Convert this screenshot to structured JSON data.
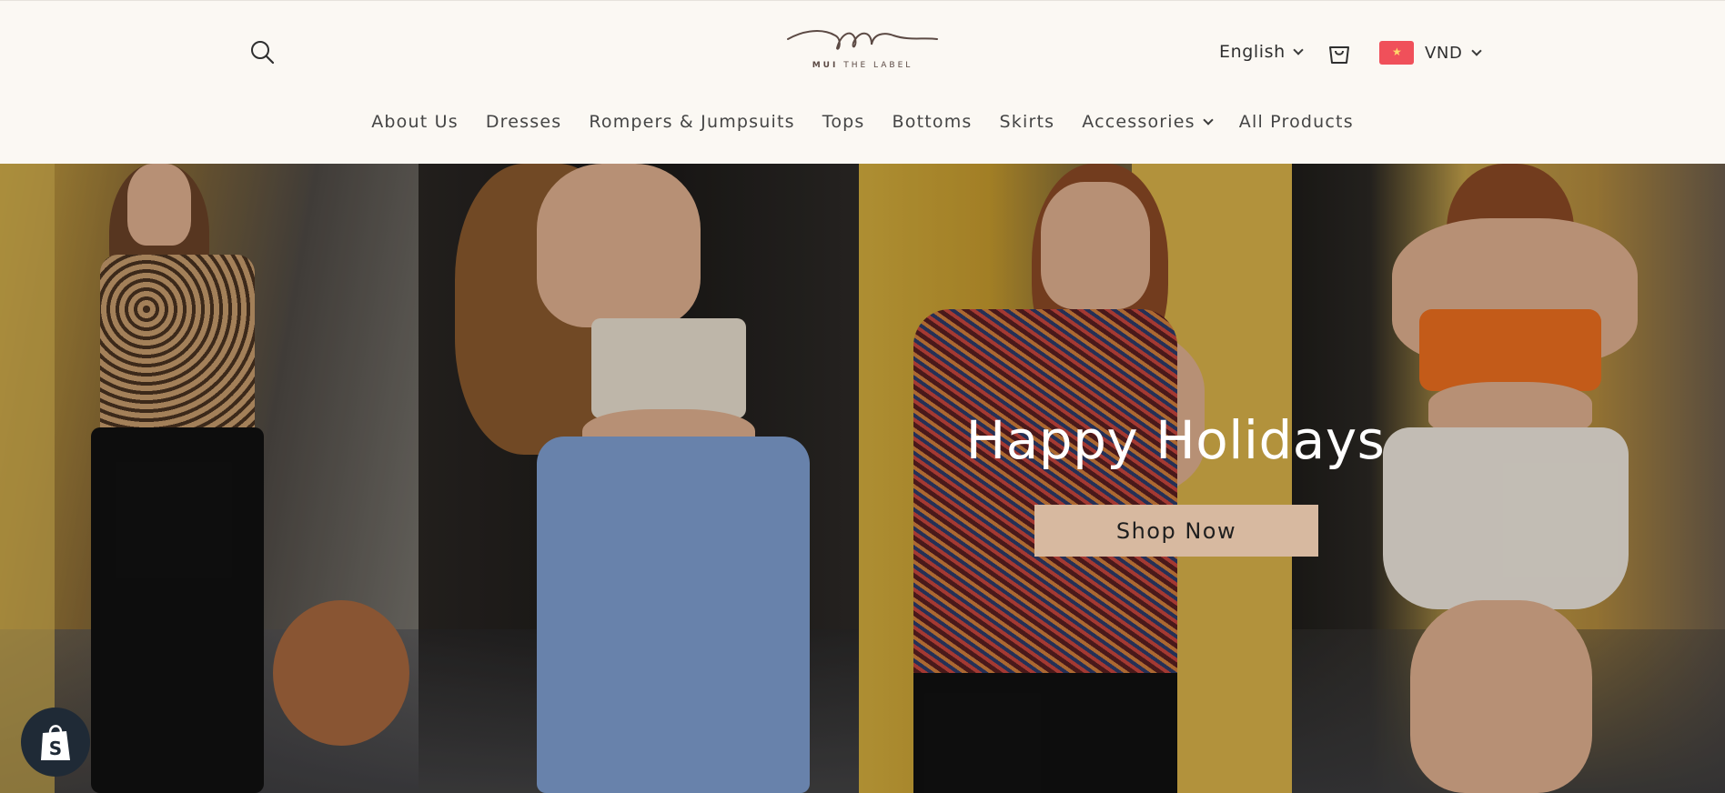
{
  "header": {
    "logo_text_bold": "MUI",
    "logo_text": "THE LABEL",
    "language": "English",
    "currency": "VND"
  },
  "nav": {
    "items": [
      {
        "label": "About Us"
      },
      {
        "label": "Dresses"
      },
      {
        "label": "Rompers & Jumpsuits"
      },
      {
        "label": "Tops"
      },
      {
        "label": "Bottoms"
      },
      {
        "label": "Skirts"
      },
      {
        "label": "Accessories",
        "has_dropdown": true
      },
      {
        "label": "All Products"
      }
    ]
  },
  "hero": {
    "title": "Happy Holidays",
    "button_label": "Shop Now"
  },
  "colors": {
    "background": "#fbf8f3",
    "button": "#d7b9a0",
    "flag": "#f0505a"
  },
  "icons": [
    "search-icon",
    "cart-icon",
    "chevron-down-icon",
    "vietnam-flag-icon",
    "shopify-bag-icon"
  ]
}
